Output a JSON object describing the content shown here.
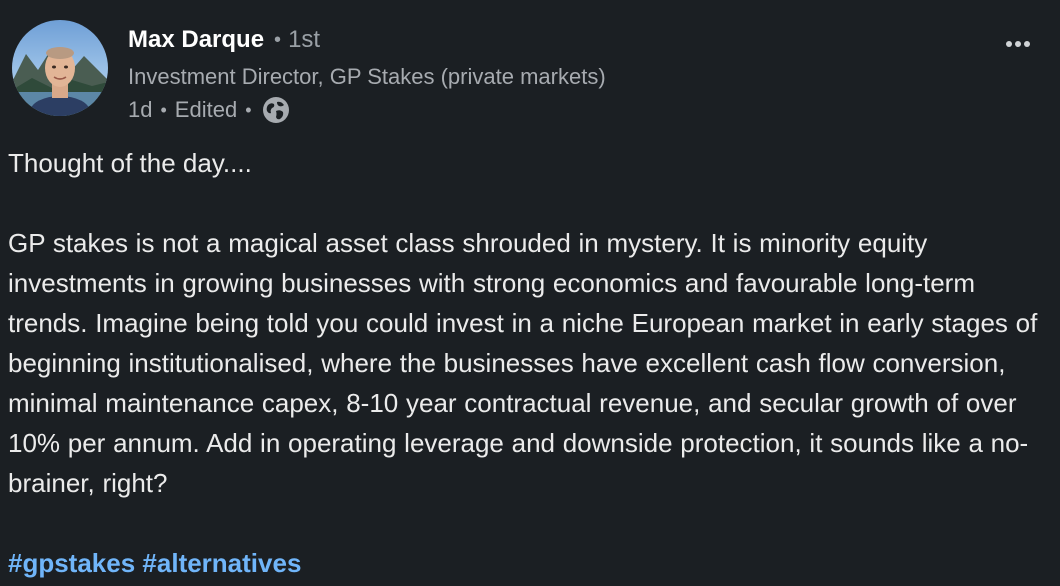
{
  "post": {
    "author": {
      "name": "Max Darque",
      "separator": "•",
      "connection_degree": "1st",
      "headline": "Investment Director, GP Stakes (private markets)",
      "avatar_icon": "profile-photo"
    },
    "meta": {
      "time_ago": "1d",
      "separator": "•",
      "edited": "Edited",
      "visibility_icon": "globe-icon"
    },
    "menu_icon": "more-horizontal-icon",
    "body": {
      "intro": "Thought of the day....",
      "main": "GP stakes is not a magical asset class shrouded in mystery. It is minority equity investments in growing businesses with strong economics and favourable long-term trends. Imagine being told you could invest in a niche European market in early stages of beginning institutionalised, where the businesses have excellent cash flow conversion, minimal maintenance capex, 8-10 year contractual revenue, and secular growth of over 10% per annum. Add in operating leverage and downside protection, it sounds like a no-brainer, right?"
    },
    "hashtags": [
      "#gpstakes",
      "#alternatives"
    ]
  },
  "colors": {
    "background": "#1b1f23",
    "text": "#ebebeb",
    "secondary_text": "#a7abb0",
    "link": "#70b5f9"
  }
}
